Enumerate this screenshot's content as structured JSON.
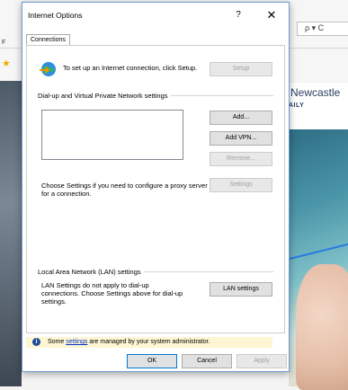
{
  "background": {
    "search_placeholder": "ρ ▾ C",
    "address_letter": "F",
    "news_title": "Newcastle",
    "news_subtitle": "AILY"
  },
  "dialog": {
    "title": "Internet Options",
    "help_glyph": "?",
    "close_glyph": "✕",
    "tab": "Connections",
    "setup_text": "To set up an Internet connection, click Setup.",
    "setup_button": "Setup",
    "vpn_group_label": "Dial-up and Virtual Private Network settings",
    "add_button": "Add...",
    "add_vpn_button": "Add VPN...",
    "remove_button": "Remove...",
    "proxy_text": "Choose Settings if you need to configure a proxy server for a connection.",
    "settings_button": "Settings",
    "lan_group_label": "Local Area Network (LAN) settings",
    "lan_text": "LAN Settings do not apply to dial-up connections. Choose Settings above for dial-up settings.",
    "lan_button": "LAN settings",
    "info_prefix": "Some",
    "info_link": "settings",
    "info_suffix": "are managed by your system administrator.",
    "ok_button": "OK",
    "cancel_button": "Cancel",
    "apply_button": "Apply"
  },
  "colors": {
    "dialog_border": "#6f9bd1",
    "info_bar": "#fdf6d3",
    "link": "#0033cc",
    "accent_arrow": "#2a7be4"
  }
}
